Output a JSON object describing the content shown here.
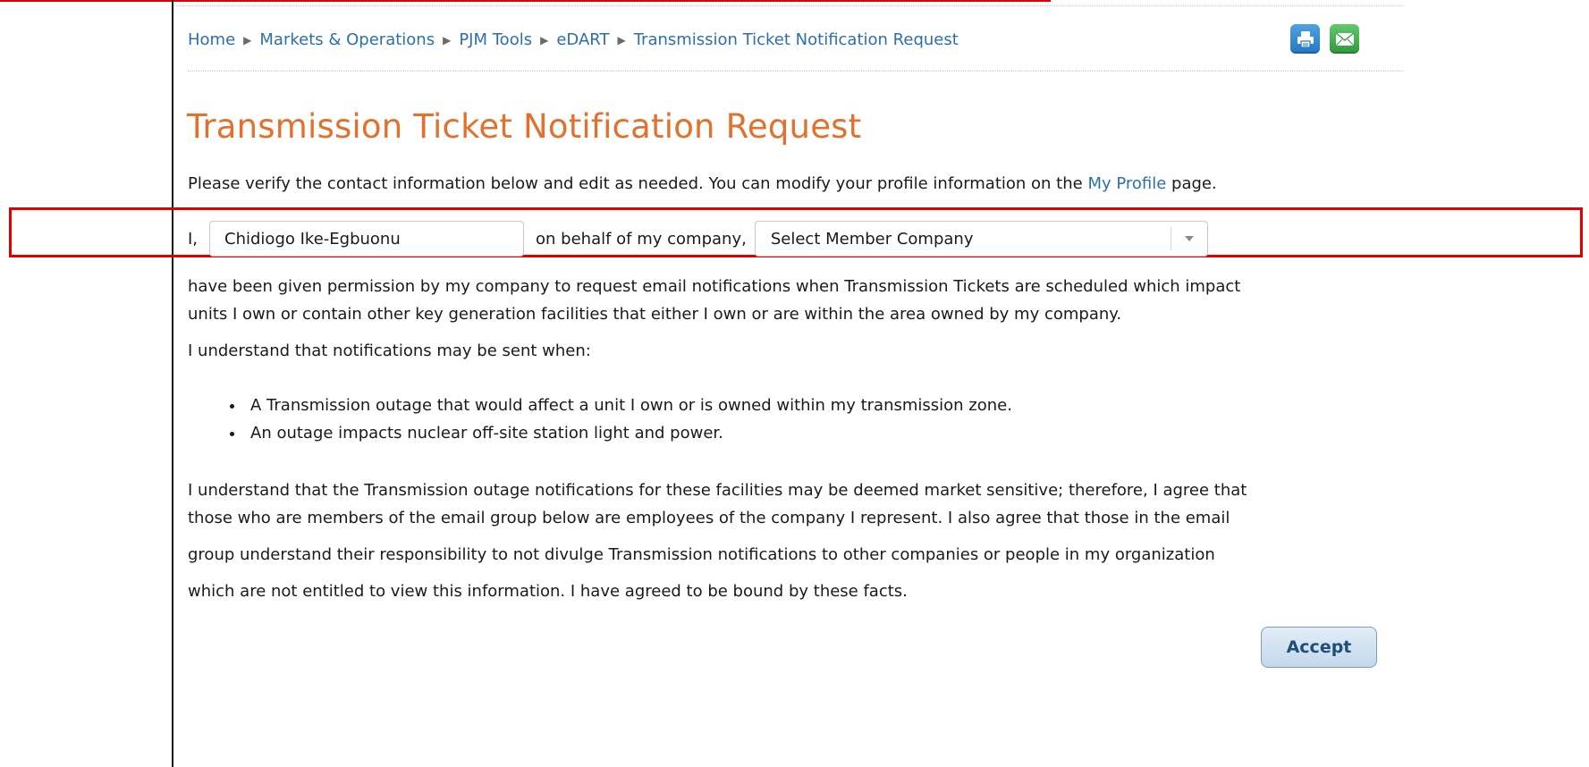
{
  "breadcrumb": {
    "items": [
      "Home",
      "Markets & Operations",
      "PJM Tools",
      "eDART",
      "Transmission Ticket Notification Request"
    ],
    "separator": "▶"
  },
  "header_icons": {
    "print": "print-icon",
    "email": "email-icon"
  },
  "page_title": "Transmission Ticket Notification Request",
  "intro": {
    "text_before": "Please verify the contact information below and edit as needed. You can modify your profile information on the ",
    "link": "My Profile",
    "text_after": " page."
  },
  "form": {
    "prefix": "I,",
    "name_value": "Chidiogo Ike-Egbuonu",
    "middle": "on behalf of my company,",
    "company_selected": "Select Member Company"
  },
  "permission_lines": [
    "have been given permission by my company to request email notifications when Transmission Tickets are scheduled which impact",
    "units I own or contain other key generation facilities that either I own or are within the area owned by my company.",
    "I understand that notifications may be sent when:"
  ],
  "conditions": [
    "A Transmission outage that would affect a unit I own or is owned within my transmission zone.",
    "An outage impacts nuclear off-site station light and power."
  ],
  "agreement_lines": [
    "I understand that the Transmission outage notifications for these facilities may be deemed market sensitive; therefore, I agree that",
    "those who are members of the email group below are employees of the company I represent. I also agree that those in the email",
    "group understand their responsibility to not divulge Transmission notifications to other companies or people in my organization",
    "which are not entitled to view this information. I have agreed to be bound by these facts."
  ],
  "accept_label": "Accept",
  "colors": {
    "title": "#e3702d",
    "link": "#2c6fae",
    "highlight": "#e00000"
  }
}
